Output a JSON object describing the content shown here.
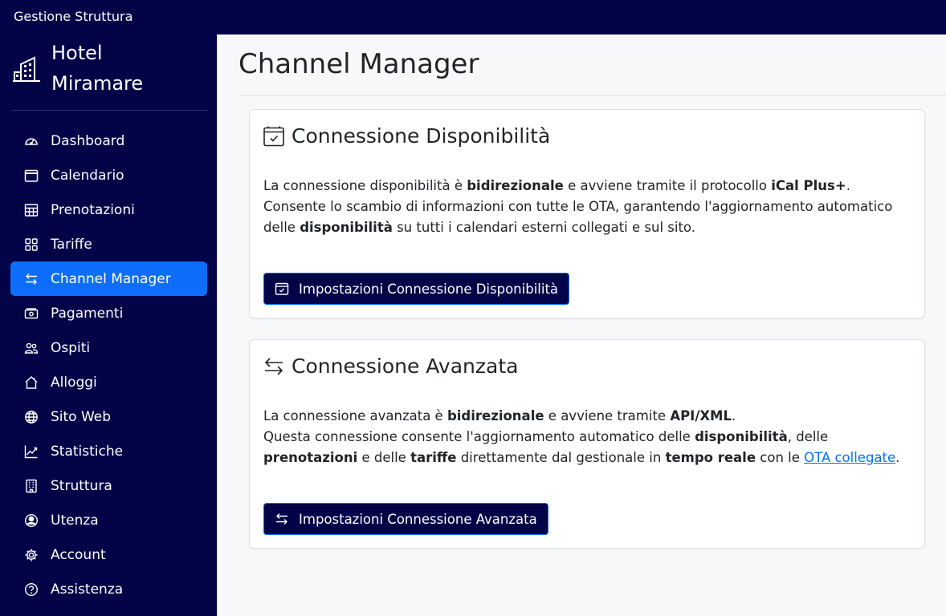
{
  "topbar": {
    "brand": "Gestione Struttura"
  },
  "sidebar": {
    "hotel_name": "Hotel Miramare",
    "items": [
      {
        "label": "Dashboard",
        "icon": "speedometer-icon"
      },
      {
        "label": "Calendario",
        "icon": "calendar-icon"
      },
      {
        "label": "Prenotazioni",
        "icon": "table-icon"
      },
      {
        "label": "Tariffe",
        "icon": "grid-icon"
      },
      {
        "label": "Channel Manager",
        "icon": "arrows-exchange-icon",
        "active": true
      },
      {
        "label": "Pagamenti",
        "icon": "cash-icon"
      },
      {
        "label": "Ospiti",
        "icon": "people-icon"
      },
      {
        "label": "Alloggi",
        "icon": "house-icon"
      },
      {
        "label": "Sito Web",
        "icon": "globe-icon"
      },
      {
        "label": "Statistiche",
        "icon": "graph-up-icon"
      },
      {
        "label": "Struttura",
        "icon": "building-icon"
      },
      {
        "label": "Utenza",
        "icon": "person-circle-icon"
      },
      {
        "label": "Account",
        "icon": "gear-icon"
      },
      {
        "label": "Assistenza",
        "icon": "question-circle-icon"
      }
    ]
  },
  "main": {
    "title": "Channel Manager",
    "cards": [
      {
        "title": "Connessione Disponibilità",
        "icon": "calendar-check-icon",
        "p1_a": "La connessione disponibilità è ",
        "p1_b": "bidirezionale",
        "p1_c": " e avviene tramite il protocollo ",
        "p1_d": "iCal Plus+",
        "p1_e": ".",
        "p2_a": "Consente lo scambio di informazioni con tutte le OTA, garantendo l'aggiornamento automatico delle ",
        "p2_b": "disponibilità",
        "p2_c": " su tutti i calendari esterni collegati e sul sito.",
        "button": "Impostazioni Connessione Disponibilità"
      },
      {
        "title": "Connessione Avanzata",
        "icon": "arrows-exchange-icon",
        "p1_a": "La connessione avanzata è ",
        "p1_b": "bidirezionale",
        "p1_c": " e avviene tramite ",
        "p1_d": "API/XML",
        "p1_e": ".",
        "p2_a": "Questa connessione consente l'aggiornamento automatico delle ",
        "p2_b": "disponibilità",
        "p2_c": ", delle ",
        "p2_d": "prenotazioni",
        "p2_e": " e delle ",
        "p2_f": "tariffe",
        "p2_g": " direttamente dal gestionale in ",
        "p2_h": "tempo reale",
        "p2_i": " con le ",
        "p2_link": "OTA collegate",
        "p2_j": ".",
        "button": "Impostazioni Connessione Avanzata"
      }
    ]
  },
  "colors": {
    "navy": "#030348",
    "active": "#0d6efd",
    "link": "#0d6efd"
  }
}
